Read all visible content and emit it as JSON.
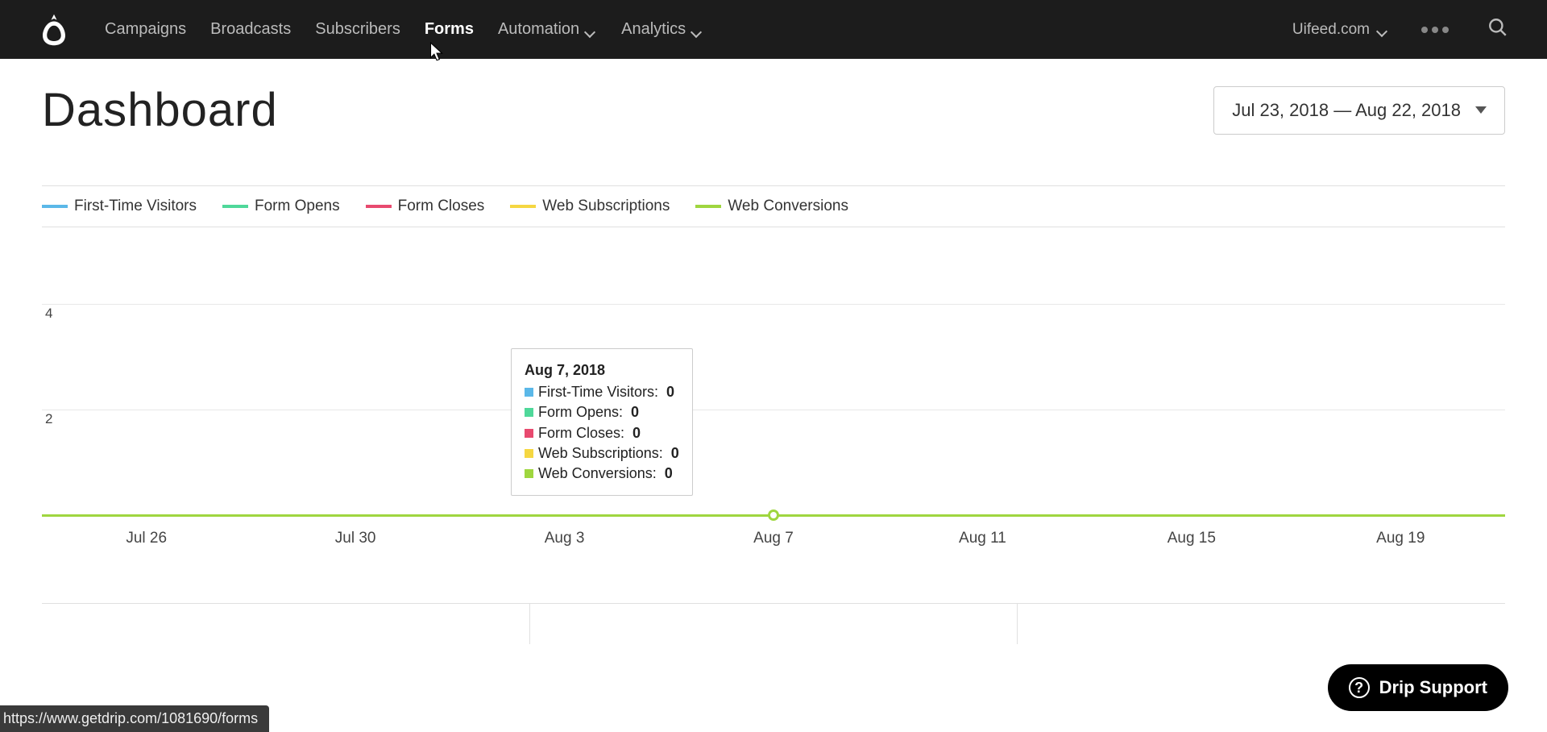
{
  "nav": {
    "items": [
      {
        "label": "Campaigns",
        "has_dropdown": false
      },
      {
        "label": "Broadcasts",
        "has_dropdown": false
      },
      {
        "label": "Subscribers",
        "has_dropdown": false
      },
      {
        "label": "Forms",
        "has_dropdown": false,
        "active": true
      },
      {
        "label": "Automation",
        "has_dropdown": true
      },
      {
        "label": "Analytics",
        "has_dropdown": true
      }
    ],
    "account_label": "Uifeed.com"
  },
  "page": {
    "title": "Dashboard",
    "date_range": "Jul 23, 2018 — Aug 22, 2018"
  },
  "legend": [
    {
      "label": "First-Time Visitors",
      "color": "#5bb8e8"
    },
    {
      "label": "Form Opens",
      "color": "#4fd89a"
    },
    {
      "label": "Form Closes",
      "color": "#e84a6f"
    },
    {
      "label": "Web Subscriptions",
      "color": "#f5d742"
    },
    {
      "label": "Web Conversions",
      "color": "#9fd63f"
    }
  ],
  "chart_data": {
    "type": "line",
    "x_categories": [
      "Jul 26",
      "Jul 30",
      "Aug 3",
      "Aug 7",
      "Aug 11",
      "Aug 15",
      "Aug 19"
    ],
    "y_ticks": [
      2,
      4
    ],
    "ylim": [
      0,
      5
    ],
    "series": [
      {
        "name": "First-Time Visitors",
        "color": "#5bb8e8",
        "values": [
          0,
          0,
          0,
          0,
          0,
          0,
          0
        ]
      },
      {
        "name": "Form Opens",
        "color": "#4fd89a",
        "values": [
          0,
          0,
          0,
          0,
          0,
          0,
          0
        ]
      },
      {
        "name": "Form Closes",
        "color": "#e84a6f",
        "values": [
          0,
          0,
          0,
          0,
          0,
          0,
          0
        ]
      },
      {
        "name": "Web Subscriptions",
        "color": "#f5d742",
        "values": [
          0,
          0,
          0,
          0,
          0,
          0,
          0
        ]
      },
      {
        "name": "Web Conversions",
        "color": "#9fd63f",
        "values": [
          0,
          0,
          0,
          0,
          0,
          0,
          0
        ]
      }
    ],
    "highlight_point_index": 3,
    "highlight_color": "#9fd63f"
  },
  "tooltip": {
    "date": "Aug 7, 2018",
    "rows": [
      {
        "label": "First-Time Visitors:",
        "value": "0",
        "color": "#5bb8e8"
      },
      {
        "label": "Form Opens:",
        "value": "0",
        "color": "#4fd89a"
      },
      {
        "label": "Form Closes:",
        "value": "0",
        "color": "#e84a6f"
      },
      {
        "label": "Web Subscriptions:",
        "value": "0",
        "color": "#f5d742"
      },
      {
        "label": "Web Conversions:",
        "value": "0",
        "color": "#9fd63f"
      }
    ]
  },
  "support_label": "Drip Support",
  "status_url": "https://www.getdrip.com/1081690/forms"
}
